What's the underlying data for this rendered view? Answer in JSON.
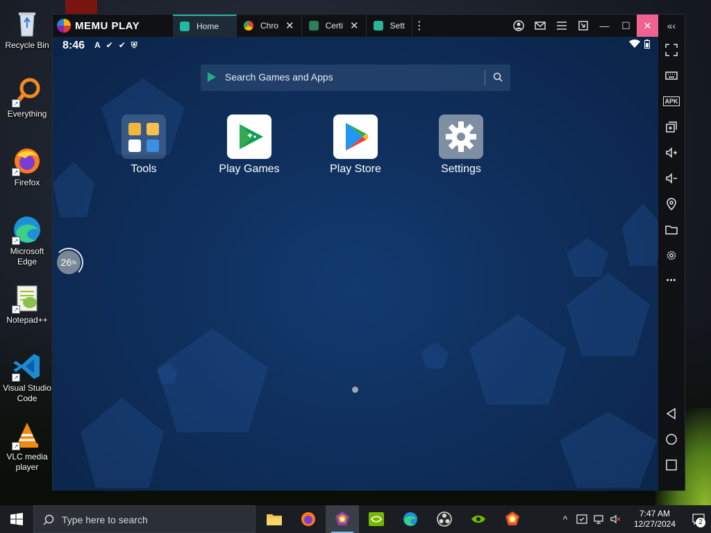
{
  "desktop": {
    "icons": [
      {
        "label": "Recycle Bin",
        "icon": "recycle-bin-icon"
      },
      {
        "label": "Everything",
        "icon": "search-magnifier-icon"
      },
      {
        "label": "Firefox",
        "icon": "firefox-icon"
      },
      {
        "label": "Microsoft Edge",
        "icon": "edge-icon"
      },
      {
        "label": "Notepad++",
        "icon": "notepad-plus-plus-icon"
      },
      {
        "label": "Visual Studio Code",
        "icon": "vscode-icon"
      },
      {
        "label": "VLC media player",
        "icon": "vlc-icon"
      }
    ]
  },
  "memu": {
    "brand": "MEMU PLAY",
    "tabs": [
      {
        "label": "Home",
        "active": true,
        "icon": "home-tab-icon",
        "color": "#22b8a6"
      },
      {
        "label": "Chro",
        "active": false,
        "icon": "chrome-icon",
        "closable": true
      },
      {
        "label": "Certi",
        "active": false,
        "icon": "android-icon",
        "closable": true
      },
      {
        "label": "Sett",
        "active": false,
        "icon": "settings-tab-icon"
      }
    ],
    "close_glyph": "✕",
    "more_glyph": "⋮",
    "window_controls": {
      "account": "account-icon",
      "mail": "mail-icon",
      "menu": "menu-icon",
      "shrink": "shrink-icon",
      "minimize": "—",
      "maximize": "☐",
      "close": "✕",
      "collapse": "«‹"
    },
    "statusbar": {
      "time": "8:46",
      "left_icons": [
        "A",
        "✔",
        "✔",
        "⛨"
      ],
      "right_icons": [
        "wifi-icon",
        "battery-icon"
      ]
    },
    "search": {
      "placeholder": "Search Games and Apps"
    },
    "apps": [
      {
        "label": "Tools",
        "icon": "tools-folder-icon"
      },
      {
        "label": "Play Games",
        "icon": "play-games-icon"
      },
      {
        "label": "Play Store",
        "icon": "play-store-icon"
      },
      {
        "label": "Settings",
        "icon": "settings-gear-icon"
      }
    ],
    "loader": {
      "value": "26",
      "unit": "%"
    },
    "sidebar": [
      "fullscreen-icon",
      "keyboard-icon",
      "apk-icon",
      "multi-window-icon",
      "volume-up-icon",
      "volume-down-icon",
      "location-icon",
      "folder-icon",
      "settings-icon",
      "more-icon",
      "back-icon",
      "home-icon",
      "recents-icon"
    ],
    "apk_label": "APK",
    "more_dots": "•••",
    "colors": {
      "accent": "#22b8a6",
      "close_button": "#f06292",
      "screen_bg": "#0f2f5c"
    }
  },
  "taskbar": {
    "search_placeholder": "Type here to search",
    "apps": [
      {
        "name": "file-explorer-icon"
      },
      {
        "name": "firefox-icon"
      },
      {
        "name": "memu-icon",
        "active": true
      },
      {
        "name": "nvidia-icon"
      },
      {
        "name": "edge-icon"
      },
      {
        "name": "obs-icon"
      },
      {
        "name": "nvidia-geforce-icon"
      },
      {
        "name": "memu-multi-icon"
      }
    ],
    "tray": {
      "chevron": "^",
      "time": "7:47 AM",
      "date": "12/27/2024",
      "notifications": "2"
    }
  }
}
